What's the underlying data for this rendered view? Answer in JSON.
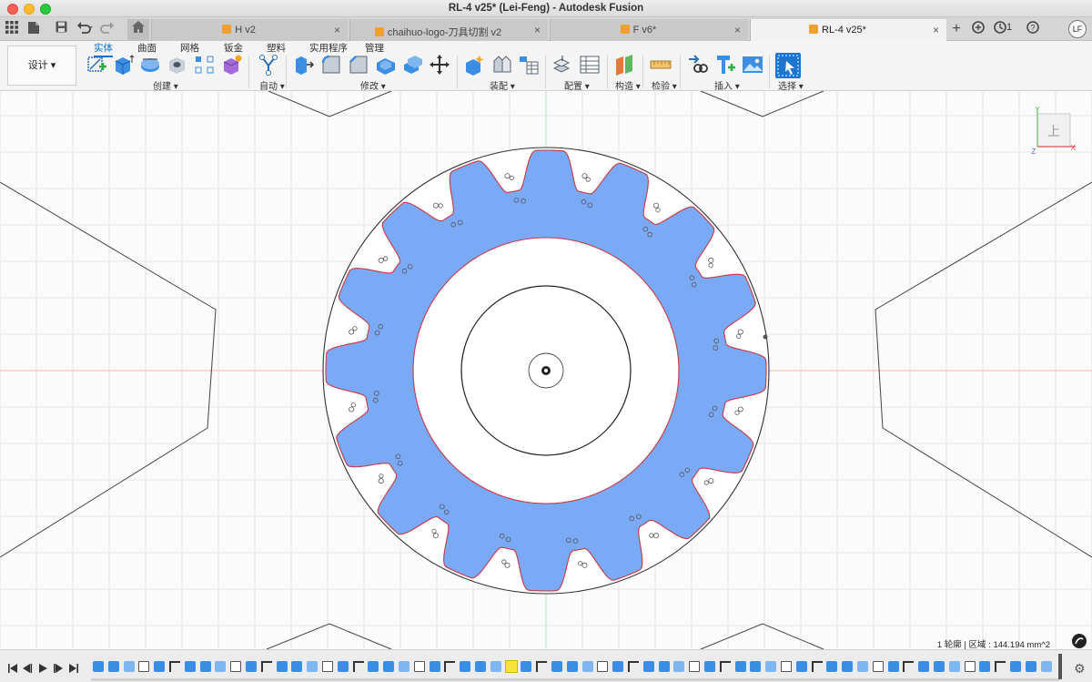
{
  "window": {
    "title": "RL-4 v25* (Lei-Feng) - Autodesk Fusion"
  },
  "tabbar": {
    "tabs": [
      {
        "label": "H v2",
        "active": false
      },
      {
        "label": "chaihuo-logo-刀具切割 v2",
        "active": false
      },
      {
        "label": "F v6*",
        "active": false
      },
      {
        "label": "RL-4 v25*",
        "active": true
      }
    ],
    "close_glyph": "×",
    "job_count": "1",
    "user_initials": "LF",
    "icons": [
      "app-grid-icon",
      "file-icon",
      "save-icon",
      "undo-icon",
      "redo-icon",
      "home-icon",
      "new-tab-icon",
      "extensions-icon",
      "job-status-icon",
      "help-icon"
    ]
  },
  "toolbar": {
    "workspace_label": "设计 ▾",
    "ribbon_tabs": [
      {
        "label": "实体",
        "active": true
      },
      {
        "label": "曲面",
        "active": false
      },
      {
        "label": "网格",
        "active": false
      },
      {
        "label": "钣金",
        "active": false
      },
      {
        "label": "塑料",
        "active": false
      },
      {
        "label": "实用程序",
        "active": false
      },
      {
        "label": "管理",
        "active": false
      }
    ],
    "groups": [
      {
        "label": "创建 ▾"
      },
      {
        "label": "自动 ▾"
      },
      {
        "label": "修改 ▾"
      },
      {
        "label": "装配 ▾"
      },
      {
        "label": "配置 ▾"
      },
      {
        "label": "构造 ▾"
      },
      {
        "label": "检验 ▾"
      },
      {
        "label": "插入 ▾"
      },
      {
        "label": "选择 ▾"
      }
    ],
    "tool_icons": [
      "create-sketch-icon",
      "extrude-icon",
      "revolve-icon",
      "hole-icon",
      "pattern-icon",
      "create-form-icon",
      "automate-icon",
      "press-pull-icon",
      "fillet-icon",
      "chamfer-icon",
      "shell-icon",
      "combine-icon",
      "move-icon",
      "new-component-icon",
      "joint-icon",
      "bom-icon",
      "configure-icon",
      "table-icon",
      "offset-plane-icon",
      "measure-icon",
      "insert-derive-icon",
      "insert-mcmaster-icon",
      "insert-image-icon",
      "select-icon"
    ]
  },
  "viewport": {
    "viewcube_face": "上",
    "axis_labels": {
      "x": "X",
      "y": "Y",
      "z": "Z"
    },
    "status": "1 轮廓 | 区域 : 144.194 mm^2",
    "gear": {
      "teeth": 16,
      "fill_color": "#7aa9f5",
      "profile_color": "#c8383f"
    },
    "colors": {
      "grid": "#e6e6e6",
      "axis_red": "#f2b8b8",
      "axis_green": "#b8e0b8",
      "sketch_line": "#333333"
    }
  },
  "timeline": {
    "controls": [
      "go-to-start-icon",
      "step-back-icon",
      "play-icon",
      "step-forward-icon",
      "go-to-end-icon"
    ],
    "feature_count": 63,
    "settings_icon": "gear-icon"
  }
}
